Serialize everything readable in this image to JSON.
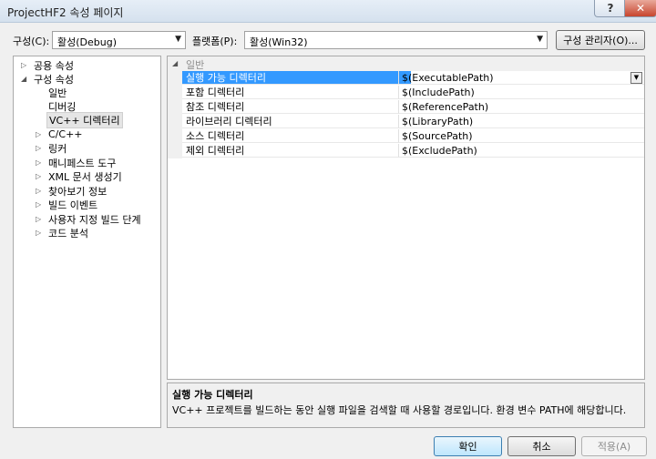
{
  "window": {
    "title": "ProjectHF2 속성 페이지",
    "help": "?",
    "close": "✕"
  },
  "config": {
    "label": "구성(C):",
    "value": "활성(Debug)"
  },
  "platform": {
    "label": "플랫폼(P):",
    "value": "활성(Win32)"
  },
  "config_manager": "구성 관리자(O)...",
  "tree": [
    {
      "label": "공용 속성",
      "exp": "▷"
    },
    {
      "label": "구성 속성",
      "exp": "◢"
    },
    {
      "label": "일반",
      "exp": ""
    },
    {
      "label": "디버깅",
      "exp": ""
    },
    {
      "label": "VC++ 디렉터리",
      "exp": "",
      "selected": true
    },
    {
      "label": "C/C++",
      "exp": "▷"
    },
    {
      "label": "링커",
      "exp": "▷"
    },
    {
      "label": "매니페스트 도구",
      "exp": "▷"
    },
    {
      "label": "XML 문서 생성기",
      "exp": "▷"
    },
    {
      "label": "찾아보기 정보",
      "exp": "▷"
    },
    {
      "label": "빌드 이벤트",
      "exp": "▷"
    },
    {
      "label": "사용자 지정 빌드 단계",
      "exp": "▷"
    },
    {
      "label": "코드 분석",
      "exp": "▷"
    }
  ],
  "grid": {
    "category": "일반",
    "category_exp": "◢",
    "rows": [
      {
        "name": "실행 가능 디렉터리",
        "value": "$(ExecutablePath)",
        "selected": true
      },
      {
        "name": "포함 디렉터리",
        "value": "$(IncludePath)"
      },
      {
        "name": "참조 디렉터리",
        "value": "$(ReferencePath)"
      },
      {
        "name": "라이브러리 디렉터리",
        "value": "$(LibraryPath)"
      },
      {
        "name": "소스 디렉터리",
        "value": "$(SourcePath)"
      },
      {
        "name": "제외 디렉터리",
        "value": "$(ExcludePath)"
      }
    ],
    "dropdown_arrow": "▼"
  },
  "description": {
    "title": "실행 가능 디렉터리",
    "text": "VC++ 프로젝트를 빌드하는 동안 실행 파일을 검색할 때 사용할 경로입니다. 환경 변수 PATH에 해당합니다."
  },
  "buttons": {
    "ok": "확인",
    "cancel": "취소",
    "apply": "적용(A)"
  }
}
